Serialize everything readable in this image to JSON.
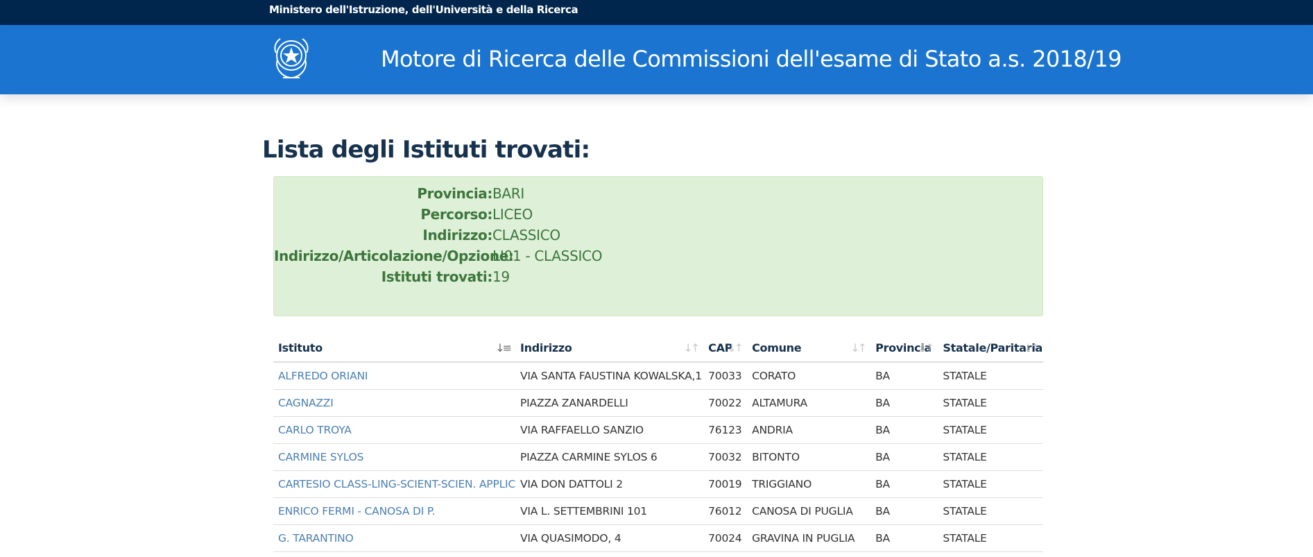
{
  "topbar": {
    "ministry": "Ministero dell'Istruzione, dell'Università e della Ricerca"
  },
  "header": {
    "emblem": "italian-republic-emblem",
    "title": "Motore di Ricerca delle Commissioni dell'esame di Stato a.s. 2018/19"
  },
  "page_title": "Lista degli Istituti trovati:",
  "summary": [
    {
      "key": "Provincia:",
      "value": "BARI"
    },
    {
      "key": "Percorso:",
      "value": "LICEO"
    },
    {
      "key": "Indirizzo:",
      "value": "CLASSICO"
    },
    {
      "key": "Indirizzo/Articolazione/Opzione:",
      "value": "LI01 - CLASSICO"
    },
    {
      "key": "Istituti trovati:",
      "value": "19"
    }
  ],
  "table": {
    "headers": [
      "Istituto",
      "Indirizzo",
      "CAP",
      "Comune",
      "Provincia",
      "Statale/Paritaria"
    ],
    "sort_icons": [
      "sort-alpha-asc-icon",
      "sort-icon",
      "sort-icon",
      "sort-icon",
      "sort-icon",
      "sort-icon"
    ],
    "rows": [
      [
        "ALFREDO ORIANI",
        "VIA SANTA FAUSTINA KOWALSKA,1",
        "70033",
        "CORATO",
        "BA",
        "STATALE"
      ],
      [
        "CAGNAZZI",
        "PIAZZA ZANARDELLI",
        "70022",
        "ALTAMURA",
        "BA",
        "STATALE"
      ],
      [
        "CARLO TROYA",
        "VIA RAFFAELLO SANZIO",
        "76123",
        "ANDRIA",
        "BA",
        "STATALE"
      ],
      [
        "CARMINE SYLOS",
        "PIAZZA CARMINE SYLOS 6",
        "70032",
        "BITONTO",
        "BA",
        "STATALE"
      ],
      [
        "CARTESIO CLASS-LING-SCIENT-SCIEN. APPLIC",
        "VIA DON DATTOLI 2",
        "70019",
        "TRIGGIANO",
        "BA",
        "STATALE"
      ],
      [
        "ENRICO FERMI - CANOSA DI P.",
        "VIA L. SETTEMBRINI 101",
        "76012",
        "CANOSA DI PUGLIA",
        "BA",
        "STATALE"
      ],
      [
        "G. TARANTINO",
        "VIA QUASIMODO, 4",
        "70024",
        "GRAVINA IN PUGLIA",
        "BA",
        "STATALE"
      ]
    ]
  }
}
